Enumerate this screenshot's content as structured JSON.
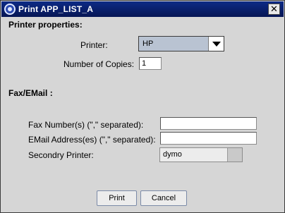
{
  "window": {
    "title": "Print APP_LIST_A",
    "close_label": "✕",
    "icon": "app-logo-icon"
  },
  "printer_section": {
    "title": "Printer properties:",
    "printer_label": "Printer:",
    "printer_value": "HP",
    "copies_label": "Number of Copies:",
    "copies_value": "1"
  },
  "fax_section": {
    "title": "Fax/EMail :",
    "fax_label": "Fax Number(s) (\",\" separated):",
    "fax_value": "",
    "email_label": "EMail Address(es) (\",\" separated):",
    "email_value": "",
    "secondary_label": "Secondry Printer:",
    "secondary_value": "dymo"
  },
  "buttons": {
    "print": "Print",
    "cancel": "Cancel"
  },
  "colors": {
    "titlebar": "#0a1f6e",
    "dialog_bg": "#d6d6d6",
    "combo_selected": "#b9c3d2"
  }
}
